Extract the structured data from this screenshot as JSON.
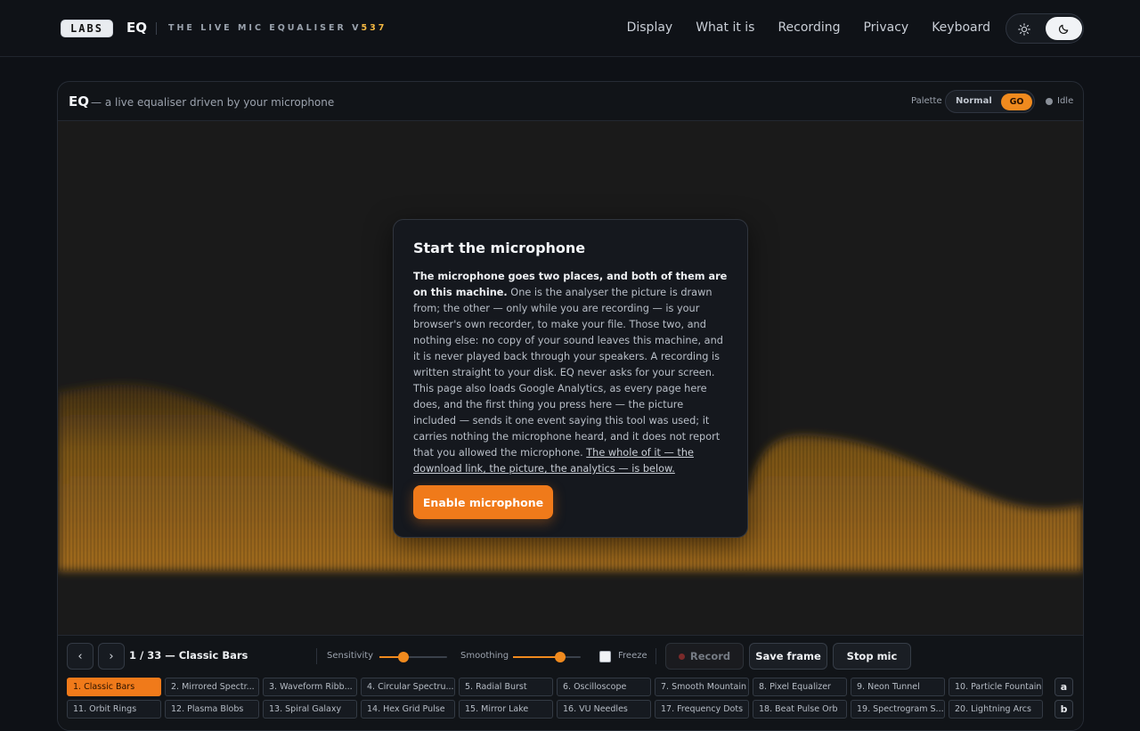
{
  "header": {
    "logo": "LABS",
    "brand": "EQ",
    "tagline": "THE LIVE MIC EQUALISER V",
    "version": "537",
    "nav": [
      "Display",
      "What it is",
      "Recording",
      "Privacy",
      "Keyboard"
    ],
    "theme_icons": {
      "light": "sun-icon",
      "dark": "moon-icon"
    },
    "theme_selected": "dark"
  },
  "panel": {
    "title": "EQ",
    "subtitle": "— a live equaliser driven by your microphone",
    "palette_label": "Palette",
    "palette_options": [
      "Normal",
      "GO"
    ],
    "palette_selected": "GO",
    "status": "Idle"
  },
  "modal": {
    "title": "Start the microphone",
    "bold_lead": "The microphone goes two places, and both of them are on this machine.",
    "body": " One is the analyser the picture is drawn from; the other — only while you are recording — is your browser's own recorder, to make your file. Those two, and nothing else: no copy of your sound leaves this machine, and it is never played back through your speakers. A recording is written straight to your disk. EQ never asks for your screen. This page also loads Google Analytics, as every page here does, and the first thing you press here — the picture included — sends it one event saying this tool was used; it carries nothing the microphone heard, and it does not report that you allowed the microphone. ",
    "link": "The whole of it — the download link, the picture, the analytics — is below.",
    "button": "Enable microphone"
  },
  "controls": {
    "prev": "‹",
    "next": "›",
    "counter": "1 / 33 — Classic Bars",
    "sensitivity_label": "Sensitivity",
    "sensitivity_value": 0.35,
    "smoothing_label": "Smoothing",
    "smoothing_value": 0.7,
    "freeze_label": "Freeze",
    "freeze_checked": false,
    "record": "Record",
    "save": "Save frame",
    "stop": "Stop mic"
  },
  "visualizers": {
    "row1": [
      "1. Classic Bars",
      "2. Mirrored Spectr...",
      "3. Waveform Ribb...",
      "4. Circular Spectru...",
      "5. Radial Burst",
      "6. Oscilloscope",
      "7. Smooth Mountain",
      "8. Pixel Equalizer",
      "9. Neon Tunnel",
      "10. Particle Fountain"
    ],
    "row2": [
      "11. Orbit Rings",
      "12. Plasma Blobs",
      "13. Spiral Galaxy",
      "14. Hex Grid Pulse",
      "15. Mirror Lake",
      "16. VU Needles",
      "17. Frequency Dots",
      "18. Beat Pulse Orb",
      "19. Spectrogram S...",
      "20. Lightning Arcs"
    ],
    "keys": [
      "a",
      "b"
    ],
    "active": 0
  }
}
